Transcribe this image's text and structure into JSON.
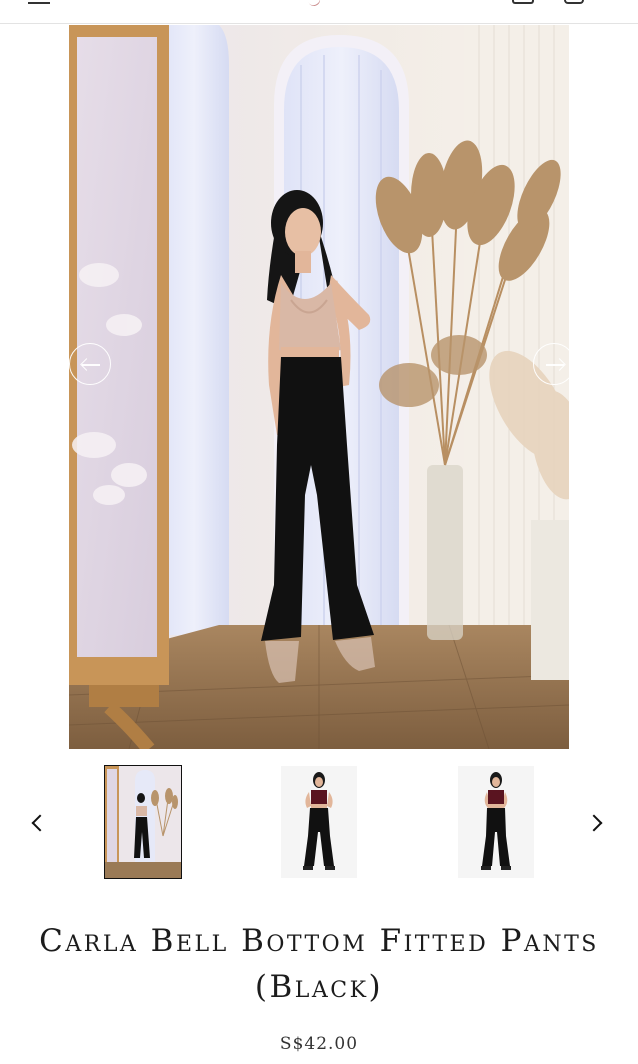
{
  "header": {
    "menu_icon": "hamburger-icon",
    "account_icon": "user-icon",
    "cart_icon": "shopping-bag-icon"
  },
  "gallery": {
    "prev_icon": "arrow-left-circle-icon",
    "next_icon": "arrow-right-circle-icon",
    "thumbnails_prev_icon": "chevron-left-icon",
    "thumbnails_next_icon": "chevron-right-icon",
    "thumbnail_count": 3,
    "active_thumbnail": 1
  },
  "product": {
    "title": "Carla Bell Bottom Fitted Pants (Black)",
    "price": "S$42.00"
  },
  "colors": {
    "pants": "#111111",
    "top": "#d9b8a6",
    "thumb_top": "#5a1420",
    "wall": "#efe9e4",
    "floor": "#9a7a56"
  }
}
